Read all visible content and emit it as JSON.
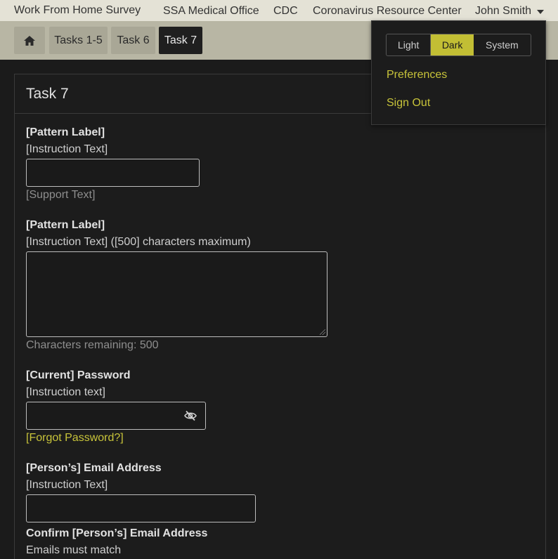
{
  "topnav": {
    "brand": "Work From Home Survey",
    "links": [
      "SSA Medical Office",
      "CDC",
      "Coronavirus Resource Center"
    ],
    "user": "John Smith"
  },
  "breadcrumb": {
    "home_icon": "home-icon",
    "items": [
      "Tasks 1-5",
      "Task 6",
      "Task 7"
    ]
  },
  "card": {
    "title": "Task 7",
    "field1": {
      "label": "[Pattern Label]",
      "instruction": "[Instruction Text]",
      "value": "",
      "support": "[Support Text]"
    },
    "field2": {
      "label": "[Pattern Label]",
      "instruction": "[Instruction Text] ([500] characters maximum)",
      "value": "",
      "remaining": "Characters remaining: 500"
    },
    "password": {
      "label": "[Current] Password",
      "instruction": "[Instruction text]",
      "value": "",
      "toggle_icon": "eye-slash-icon",
      "forgot": "[Forgot Password?]"
    },
    "email": {
      "label": "[Person’s] Email Address",
      "instruction": "[Instruction Text]",
      "value": ""
    },
    "confirm_email": {
      "label": "Confirm [Person’s] Email Address",
      "instruction": "Emails must match"
    }
  },
  "menu": {
    "themes": [
      "Light",
      "Dark",
      "System"
    ],
    "selected_theme": "Dark",
    "preferences": "Preferences",
    "sign_out": "Sign Out"
  },
  "colors": {
    "accent": "#c2be34",
    "nav_bg": "#e4e2d6",
    "band_bg": "#b8b6a4",
    "page_bg": "#1b1b1b"
  }
}
